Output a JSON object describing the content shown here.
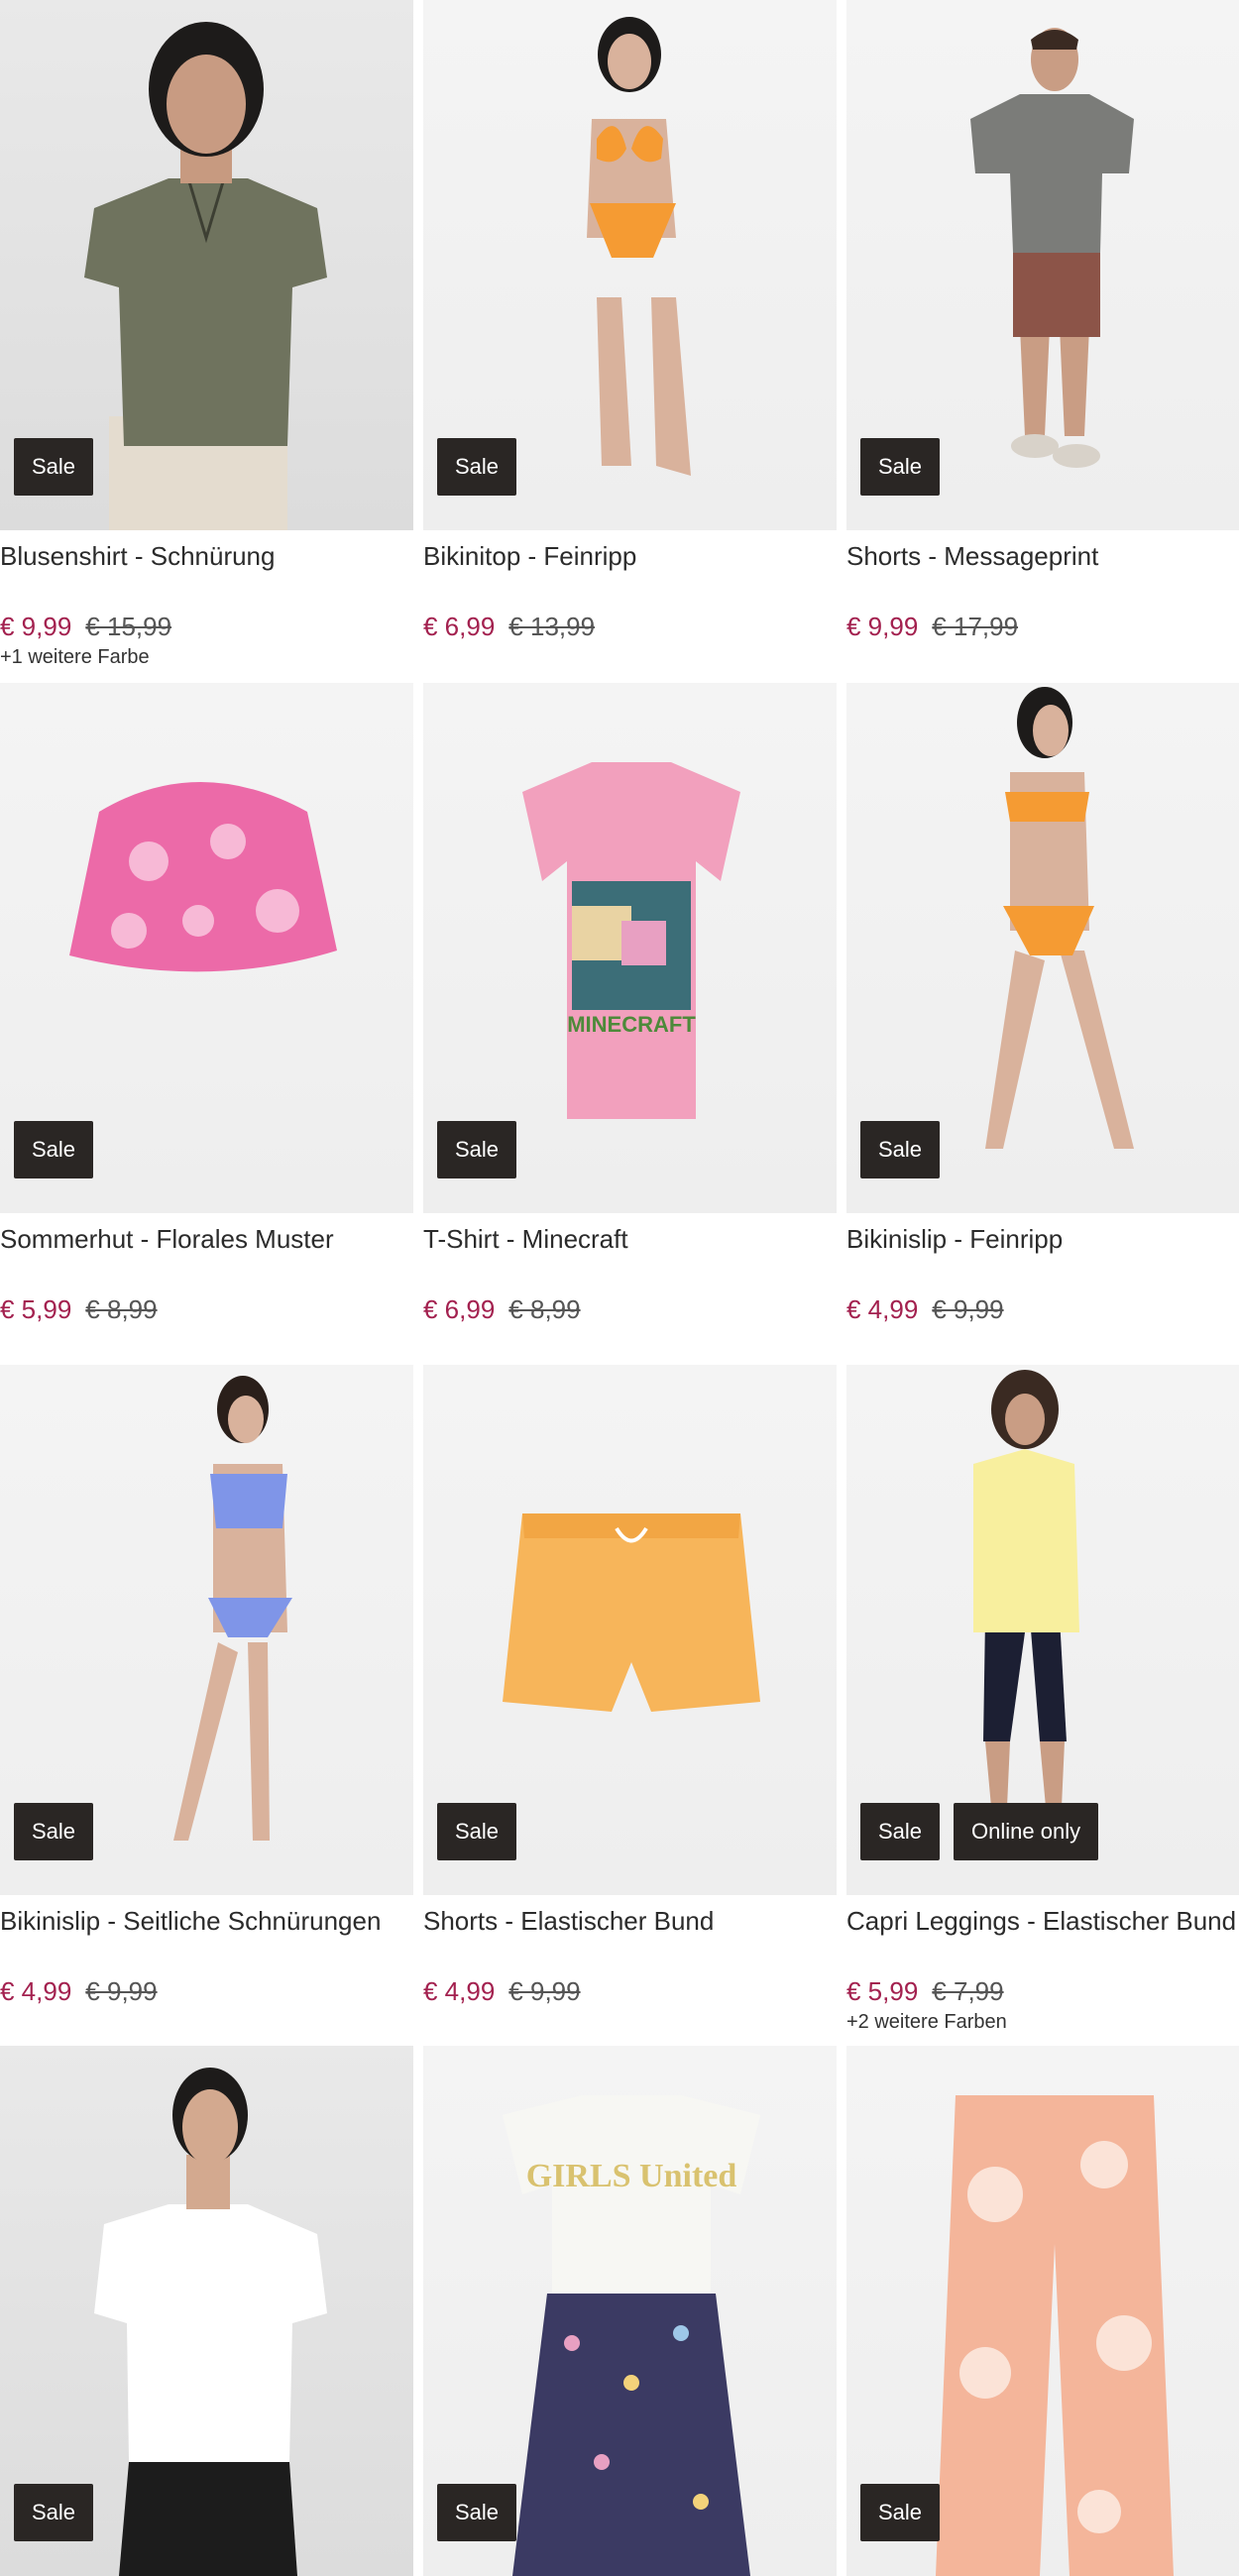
{
  "products": [
    {
      "title": "Blusenshirt - Schnürung",
      "price": "€ 9,99",
      "old_price": "€ 15,99",
      "badges": [
        "Sale"
      ],
      "colors": "+1 weitere Farbe"
    },
    {
      "title": "Bikinitop - Feinripp",
      "price": "€ 6,99",
      "old_price": "€ 13,99",
      "badges": [
        "Sale"
      ]
    },
    {
      "title": "Shorts - Messageprint",
      "price": "€ 9,99",
      "old_price": "€ 17,99",
      "badges": [
        "Sale"
      ]
    },
    {
      "title": "Sommerhut - Florales Muster",
      "price": "€ 5,99",
      "old_price": "€ 8,99",
      "badges": [
        "Sale"
      ]
    },
    {
      "title": "T-Shirt - Minecraft",
      "price": "€ 6,99",
      "old_price": "€ 8,99",
      "badges": [
        "Sale"
      ],
      "print_text": "MINECRAFT"
    },
    {
      "title": "Bikinislip - Feinripp",
      "price": "€ 4,99",
      "old_price": "€ 9,99",
      "badges": [
        "Sale"
      ]
    },
    {
      "title": "Bikinislip - Seitliche Schnürungen",
      "price": "€ 4,99",
      "old_price": "€ 9,99",
      "badges": [
        "Sale"
      ]
    },
    {
      "title": "Shorts - Elastischer Bund",
      "price": "€ 4,99",
      "old_price": "€ 9,99",
      "badges": [
        "Sale"
      ]
    },
    {
      "title": "Capri Leggings - Elastischer Bund",
      "price": "€ 5,99",
      "old_price": "€ 7,99",
      "badges": [
        "Sale",
        "Online only"
      ],
      "colors": "+2 weitere Farben"
    },
    {
      "title": "",
      "price": "",
      "old_price": "",
      "badges": [
        "Sale"
      ]
    },
    {
      "title": "",
      "price": "",
      "old_price": "",
      "badges": [
        "Sale"
      ],
      "print_text": "GIRLS United"
    },
    {
      "title": "",
      "price": "",
      "old_price": "",
      "badges": [
        "Sale"
      ]
    }
  ],
  "colors": {
    "sale_price": "#a3214f",
    "badge_bg": "#2a2624"
  }
}
